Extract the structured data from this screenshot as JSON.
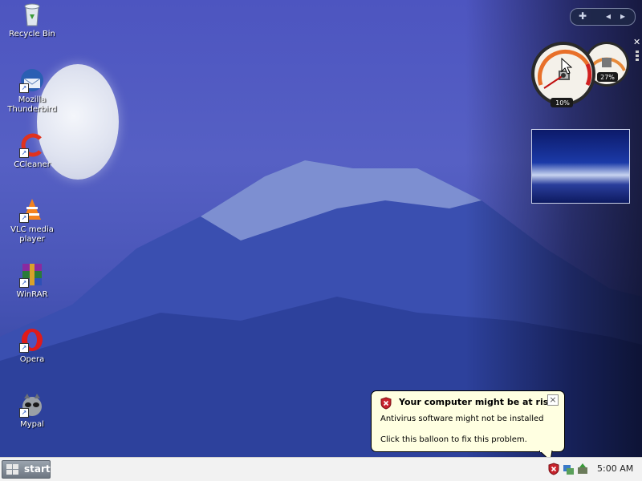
{
  "desktop": {
    "icons": [
      {
        "label": "Recycle Bin",
        "icon": "recycle-bin-icon"
      },
      {
        "label": "Mozilla Thunderbird",
        "icon": "thunderbird-icon"
      },
      {
        "label": "CCleaner",
        "icon": "ccleaner-icon"
      },
      {
        "label": "VLC media player",
        "icon": "vlc-icon"
      },
      {
        "label": "WinRAR",
        "icon": "winrar-icon"
      },
      {
        "label": "Opera",
        "icon": "opera-icon"
      },
      {
        "label": "Mypal",
        "icon": "mypal-icon"
      }
    ]
  },
  "gadgets": {
    "cpu_percent": "10%",
    "memory_percent": "27%"
  },
  "balloon": {
    "title": "Your computer might be at risk",
    "line1": "Antivirus software might not be installed",
    "line2": "Click this balloon to fix this problem.",
    "close_symbol": "×"
  },
  "taskbar": {
    "start_label": "start",
    "clock": "5:00 AM"
  },
  "colors": {
    "balloon_bg": "#ffffe1",
    "taskbar_bg": "#f2f2f2",
    "wallpaper": "#4d55c0"
  }
}
